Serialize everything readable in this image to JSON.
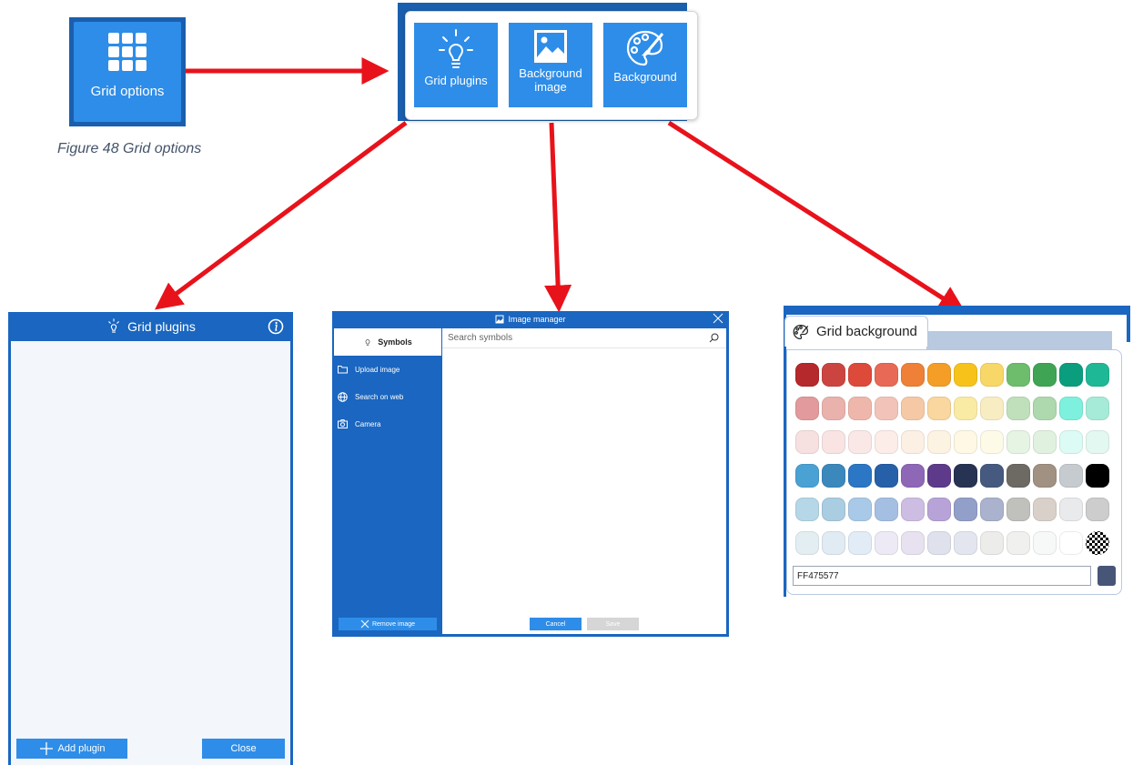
{
  "grid_options_tile": {
    "label": "Grid options"
  },
  "caption": "Figure 48 Grid options",
  "menu": {
    "buttons": [
      {
        "icon": "lightbulb-icon",
        "label": "Grid plugins"
      },
      {
        "icon": "image-icon",
        "label": "Background image"
      },
      {
        "icon": "palette-icon",
        "label": "Background"
      }
    ]
  },
  "arrows_color": "#e8121b",
  "grid_plugins": {
    "title": "Grid plugins",
    "add_label": "Add plugin",
    "close_label": "Close"
  },
  "image_manager": {
    "title": "Image manager",
    "tab_symbols": "Symbols",
    "side_items": [
      "Upload image",
      "Search on web",
      "Camera"
    ],
    "search_placeholder": "Search symbols",
    "remove_label": "Remove image",
    "cancel_label": "Cancel",
    "save_label": "Save"
  },
  "grid_background": {
    "title": "Grid background",
    "hex_value": "FF475577",
    "selected_color": "#475577",
    "swatches": [
      "#b5282b",
      "#cc4440",
      "#dd4a3a",
      "#e86955",
      "#ee8137",
      "#f49e27",
      "#f7c31b",
      "#f8d769",
      "#6dbd6c",
      "#3fa555",
      "#0b9e7e",
      "#1fb896",
      "#e29a9c",
      "#e9b2ad",
      "#efb7ab",
      "#f2c4b9",
      "#f5c9a6",
      "#f9d79e",
      "#faeba4",
      "#f8edc2",
      "#bfe0bb",
      "#aed8ae",
      "#7ef0de",
      "#a5ebd8",
      "#f7e0e0",
      "#f9e4e3",
      "#fae8e6",
      "#fcede9",
      "#fcefe3",
      "#fdf3e2",
      "#fef8e4",
      "#fefae8",
      "#e6f4e3",
      "#e0f1e0",
      "#dcfbf4",
      "#e2f8f1",
      "#4aa1d3",
      "#3b88bc",
      "#2b76c5",
      "#2660a8",
      "#8f67b7",
      "#5d3a8a",
      "#273353",
      "#465a80",
      "#6d6963",
      "#a19183",
      "#c6cbd0",
      "#000000",
      "#b5d7e8",
      "#aacde2",
      "#a9c9e8",
      "#a5bfe3",
      "#cdbde3",
      "#b8a3d8",
      "#929fc8",
      "#aab2cd",
      "#c0c0bd",
      "#d9d1c9",
      "#e8eaec",
      "#cdcdcd",
      "#e3eef3",
      "#e0ebf3",
      "#e2ecf6",
      "#ede9f5",
      "#e8e1ef",
      "#dfe2ed",
      "#e3e6ee",
      "#ececea",
      "#f0f0ee",
      "#f7f8f8",
      "#ffffff",
      "checker"
    ]
  }
}
